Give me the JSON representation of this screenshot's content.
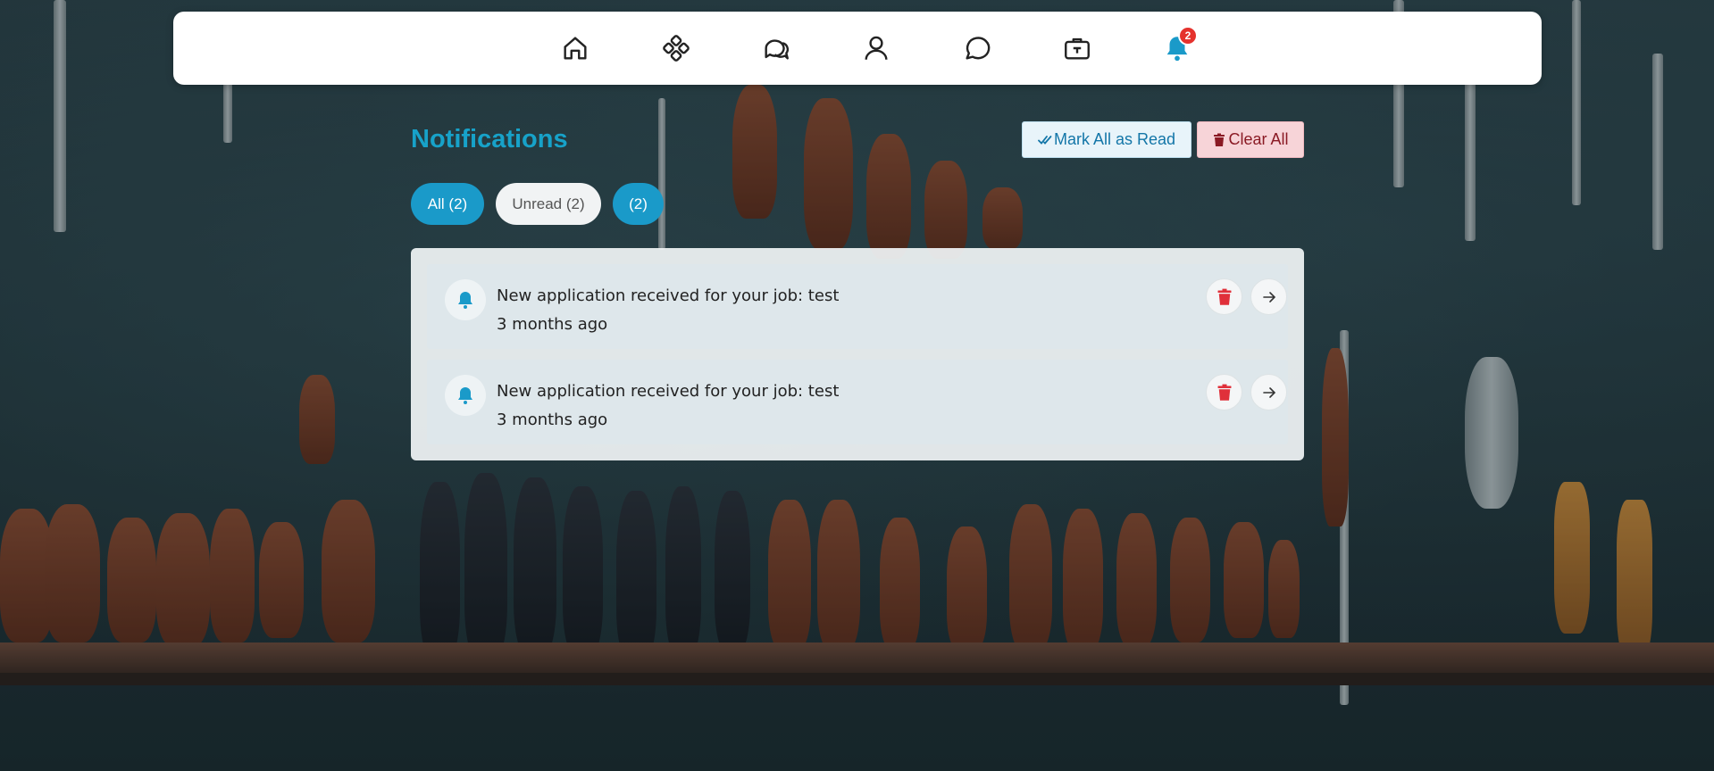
{
  "nav": {
    "items": [
      {
        "icon": "home-icon"
      },
      {
        "icon": "apps-icon"
      },
      {
        "icon": "chats-icon"
      },
      {
        "icon": "user-icon"
      },
      {
        "icon": "message-icon"
      },
      {
        "icon": "briefcase-icon"
      },
      {
        "icon": "bell-icon",
        "badge": "2"
      }
    ]
  },
  "header": {
    "title": "Notifications",
    "mark_all_label": "Mark All as Read",
    "clear_all_label": "Clear All"
  },
  "filters": {
    "all": "All (2)",
    "unread": "Unread (2)",
    "third": "(2)"
  },
  "notifications": [
    {
      "message": "New application received for your job: test",
      "time": "3 months ago"
    },
    {
      "message": "New application received for your job: test",
      "time": "3 months ago"
    }
  ],
  "colors": {
    "accent": "#17a2c9",
    "pill_active": "#1a9ac9",
    "danger": "#e5322d",
    "mark_btn_bg": "#e8f4fa",
    "clear_btn_bg": "#f7d4d8"
  }
}
